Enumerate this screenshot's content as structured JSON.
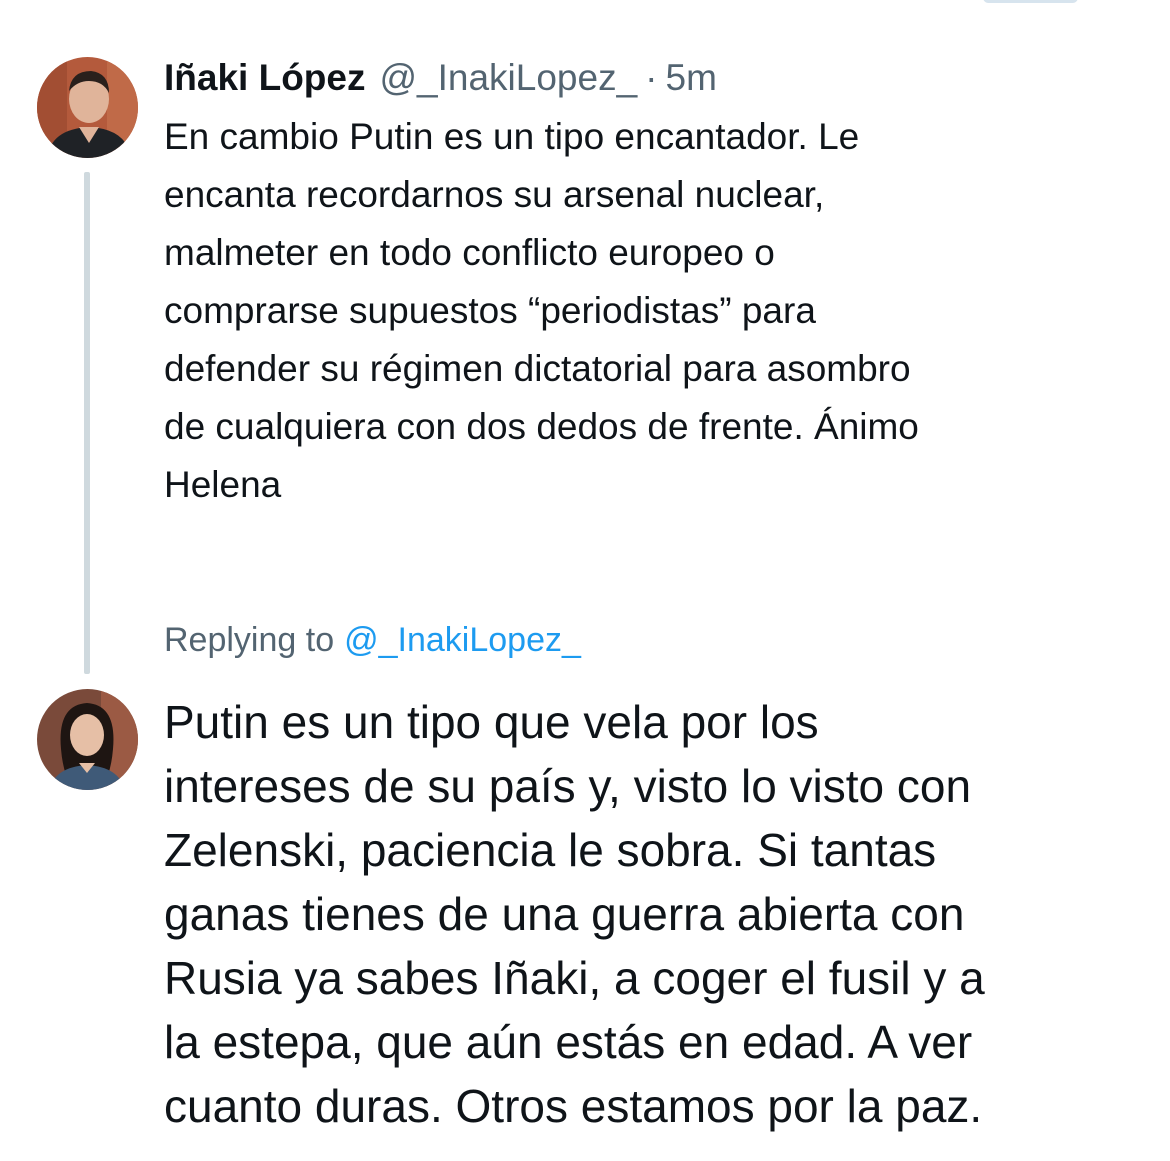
{
  "colors": {
    "text_primary": "#0f1419",
    "text_secondary": "#536471",
    "link": "#1d9bf0",
    "thread_line": "#cfd9de",
    "background": "#ffffff"
  },
  "original_tweet": {
    "author_name": "Iñaki López",
    "author_handle": "@_InakiLopez_",
    "separator": "·",
    "timestamp": "5m",
    "avatar_icon": "profile-photo-man",
    "text": "En cambio Putin es un tipo encantador. Le\nencanta recordarnos su arsenal nuclear,\nmalmeter en todo conflicto europeo o\ncomprarse supuestos “periodistas” para\ndefender su régimen dictatorial para asombro\nde cualquiera con dos dedos de frente. Ánimo\nHelena"
  },
  "reply_tweet": {
    "replying_to_label": "Replying to",
    "replying_to_handle": "@_InakiLopez_",
    "avatar_icon": "profile-photo-woman",
    "text": "Putin es un tipo que vela por los\nintereses de su país y, visto lo visto con\nZelenski, paciencia le sobra. Si tantas\nganas tienes de una guerra abierta con\nRusia ya sabes Iñaki, a coger el fusil y a\nla estepa, que aún estás en edad. A ver\ncuanto duras. Otros estamos por la paz."
  }
}
